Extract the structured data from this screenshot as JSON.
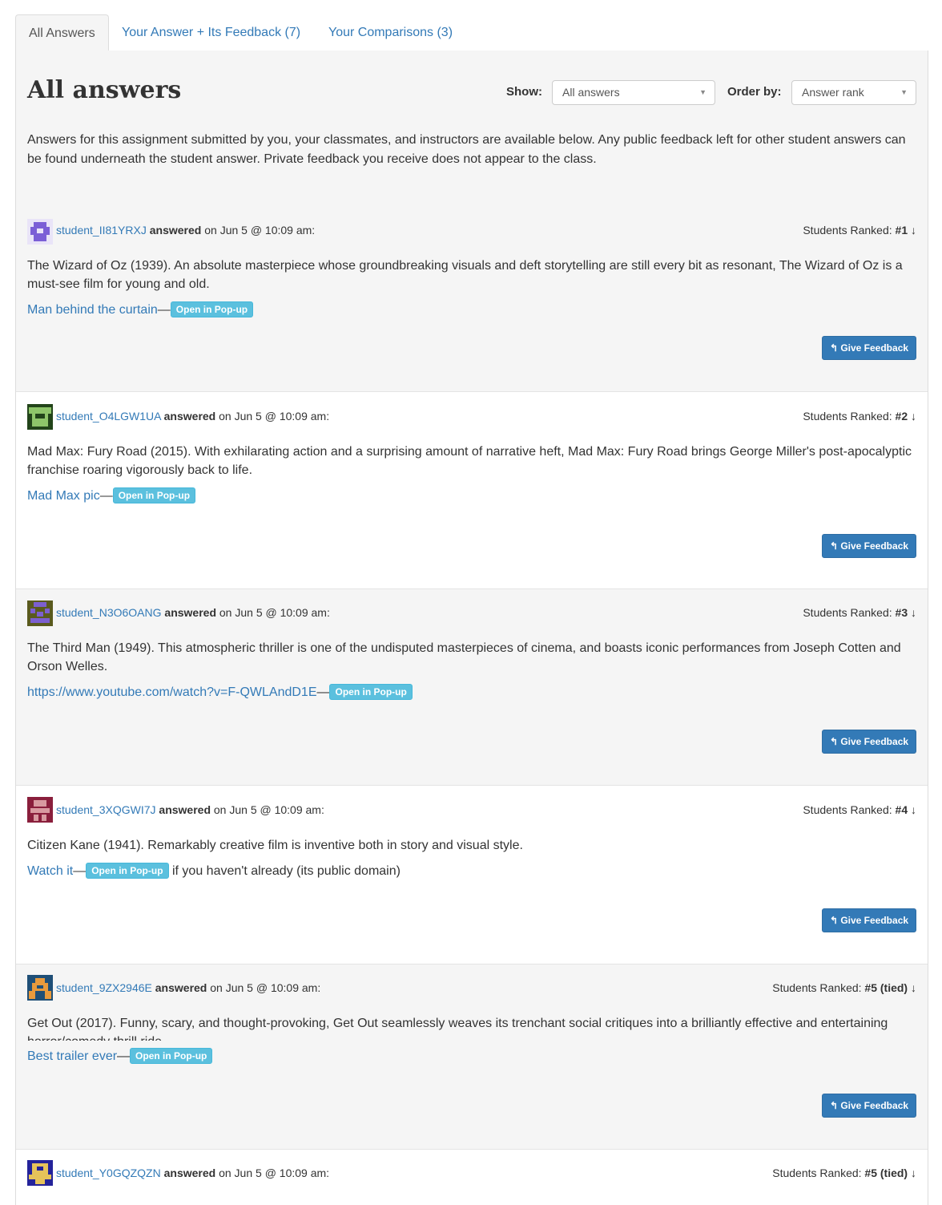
{
  "tabs": [
    {
      "label": "All Answers"
    },
    {
      "label": "Your Answer + Its Feedback (7)"
    },
    {
      "label": "Your Comparisons (3)"
    }
  ],
  "page_title": "All answers",
  "filters": {
    "show_label": "Show:",
    "show_value": "All answers",
    "order_label": "Order by:",
    "order_value": "Answer rank"
  },
  "intro": "Answers for this assignment submitted by you, your classmates, and instructors are available below. Any public feedback left for other student answers can be found underneath the student answer. Private feedback you receive does not appear to the class.",
  "common": {
    "answered": "answered",
    "on_date": "on Jun 5 @ 10:09 am:",
    "rank_prefix": "Students Ranked:",
    "rank_arrow": "🡓",
    "popup_label": "Open in Pop-up",
    "feedback_label": "↰ Give Feedback",
    "dash": "—"
  },
  "answers": [
    {
      "user": "student_II81YRXJ",
      "rank": "#1",
      "avatar_color": "#7b5fd6",
      "text": "The Wizard of Oz (1939). An absolute masterpiece whose groundbreaking visuals and deft storytelling are still every bit as resonant, The Wizard of Oz is a must-see film for young and old.",
      "link": "Man behind the curtain",
      "after": ""
    },
    {
      "user": "student_O4LGW1UA",
      "rank": "#2",
      "avatar_color": "#8ec56a",
      "text": "Mad Max: Fury Road (2015). With exhilarating action and a surprising amount of narrative heft, Mad Max: Fury Road brings George Miller's post-apocalyptic franchise roaring vigorously back to life.",
      "link": "Mad Max pic",
      "after": ""
    },
    {
      "user": "student_N3O6OANG",
      "rank": "#3",
      "avatar_color": "#7c5fd0",
      "text": "The Third Man (1949). This atmospheric thriller is one of the undisputed masterpieces of cinema, and boasts iconic performances from Joseph Cotten and Orson Welles.",
      "link": "https://www.youtube.com/watch?v=F-QWLAndD1E",
      "after": ""
    },
    {
      "user": "student_3XQGWI7J",
      "rank": "#4",
      "avatar_color": "#d89aa0",
      "text": "Citizen Kane (1941). Remarkably creative film is inventive both in story and visual style.",
      "link": "Watch it",
      "after": "if you haven't already (its public domain)"
    },
    {
      "user": "student_9ZX2946E",
      "rank": "#5 (tied)",
      "avatar_color": "#e89a3c",
      "text": "Get Out (2017). Funny, scary, and thought-provoking, Get Out seamlessly weaves its trenchant social critiques into a brilliantly effective and entertaining horror/comedy thrill ride.",
      "link": "Best trailer ever",
      "after": ""
    },
    {
      "user": "student_Y0GQZQZN",
      "rank": "#5 (tied)",
      "avatar_color": "#e6c35a",
      "text": "",
      "link": "",
      "after": ""
    }
  ]
}
